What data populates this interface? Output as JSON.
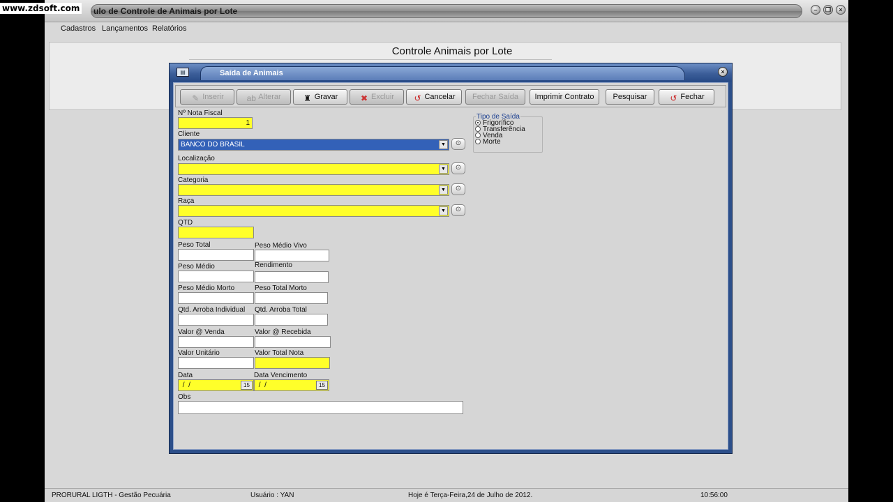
{
  "watermark": "www.zdsoft.com",
  "window": {
    "title": "ulo de Controle de Animais por Lote",
    "buttons": [
      "minimize",
      "restore",
      "close"
    ]
  },
  "menu": [
    "Cadastros",
    "Lançamentos",
    "Relatórios"
  ],
  "inner_title": "Controle Animais por Lote",
  "dialog": {
    "title": "Saída de Animais",
    "toolbar": [
      {
        "label": "Inserir",
        "enabled": false,
        "icon": "insert-icon"
      },
      {
        "label": "Alterar",
        "enabled": false,
        "icon": "edit-icon"
      },
      {
        "label": "Gravar",
        "enabled": true,
        "icon": "save-icon"
      },
      {
        "label": "Excluir",
        "enabled": false,
        "icon": "delete-icon"
      },
      {
        "label": "Cancelar",
        "enabled": true,
        "icon": "cancel-icon"
      },
      {
        "label": "Fechar Saída",
        "enabled": false,
        "icon": ""
      },
      {
        "label": "Imprimir Contrato",
        "enabled": true,
        "icon": ""
      },
      {
        "label": "Pesquisar",
        "enabled": true,
        "icon": ""
      },
      {
        "label": "Fechar",
        "enabled": true,
        "icon": "close-icon"
      }
    ],
    "fields": {
      "nota_fiscal": {
        "label": "Nº Nota Fiscal",
        "value": "1"
      },
      "cliente": {
        "label": "Cliente",
        "value": "BANCO DO BRASIL"
      },
      "localizacao": {
        "label": "Localização",
        "value": ""
      },
      "categoria": {
        "label": "Categoria",
        "value": ""
      },
      "raca": {
        "label": "Raça",
        "value": ""
      },
      "qtd": {
        "label": "QTD",
        "value": ""
      },
      "peso_total": {
        "label": "Peso Total",
        "value": ""
      },
      "peso_medio_vivo": {
        "label": "Peso Médio Vivo",
        "value": ""
      },
      "peso_medio": {
        "label": "Peso Médio",
        "value": ""
      },
      "rendimento": {
        "label": "Rendimento",
        "value": ""
      },
      "peso_medio_morto": {
        "label": "Peso Médio Morto",
        "value": ""
      },
      "peso_total_morto": {
        "label": "Peso Total Morto",
        "value": ""
      },
      "qtd_arroba_individual": {
        "label": "Qtd. Arroba Individual",
        "value": ""
      },
      "qtd_arroba_total": {
        "label": "Qtd. Arroba Total",
        "value": ""
      },
      "valor_venda": {
        "label": "Valor @ Venda",
        "value": ""
      },
      "valor_recebida": {
        "label": "Valor @ Recebida",
        "value": ""
      },
      "valor_unitario": {
        "label": "Valor Unitário",
        "value": ""
      },
      "valor_total_nota": {
        "label": "Valor Total Nota",
        "value": ""
      },
      "data": {
        "label": "Data",
        "value": " /  /"
      },
      "data_vencimento": {
        "label": "Data Vencimento",
        "value": " /  /"
      },
      "obs": {
        "label": "Obs",
        "value": ""
      }
    },
    "tipo_saida": {
      "title": "Tipo de Saída",
      "options": [
        "Frigorífico",
        "Transferência",
        "Venda",
        "Morte"
      ],
      "selected": "Frigorífico"
    }
  },
  "status_bar": {
    "app": "PRORURAL LIGTH - Gestão Pecuária",
    "user": "Usuário : YAN",
    "date": "Hoje é Terça-Feira,24 de Julho de 2012.",
    "time": "10:56:00"
  },
  "colors": {
    "required_field": "#ffff2a",
    "dialog_frame": "#2c4f8a",
    "selection": "#3361b8"
  }
}
